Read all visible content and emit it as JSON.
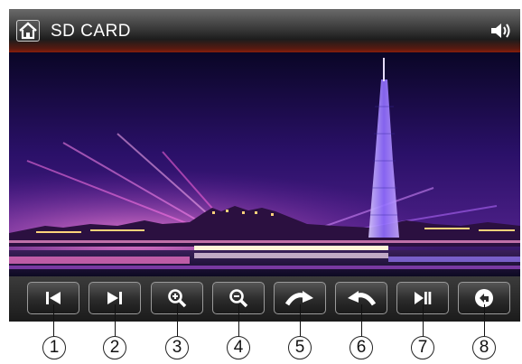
{
  "header": {
    "title": "SD CARD",
    "home_icon": "home-icon",
    "volume_icon": "speaker-volume-icon"
  },
  "toolbar": {
    "buttons": [
      {
        "icon": "skip-previous-icon"
      },
      {
        "icon": "skip-next-icon"
      },
      {
        "icon": "zoom-in-icon"
      },
      {
        "icon": "zoom-out-icon"
      },
      {
        "icon": "rotate-clockwise-icon"
      },
      {
        "icon": "rotate-counterclockwise-icon"
      },
      {
        "icon": "play-pause-icon"
      },
      {
        "icon": "back-icon"
      }
    ]
  },
  "callouts": [
    "1",
    "2",
    "3",
    "4",
    "5",
    "6",
    "7",
    "8"
  ]
}
